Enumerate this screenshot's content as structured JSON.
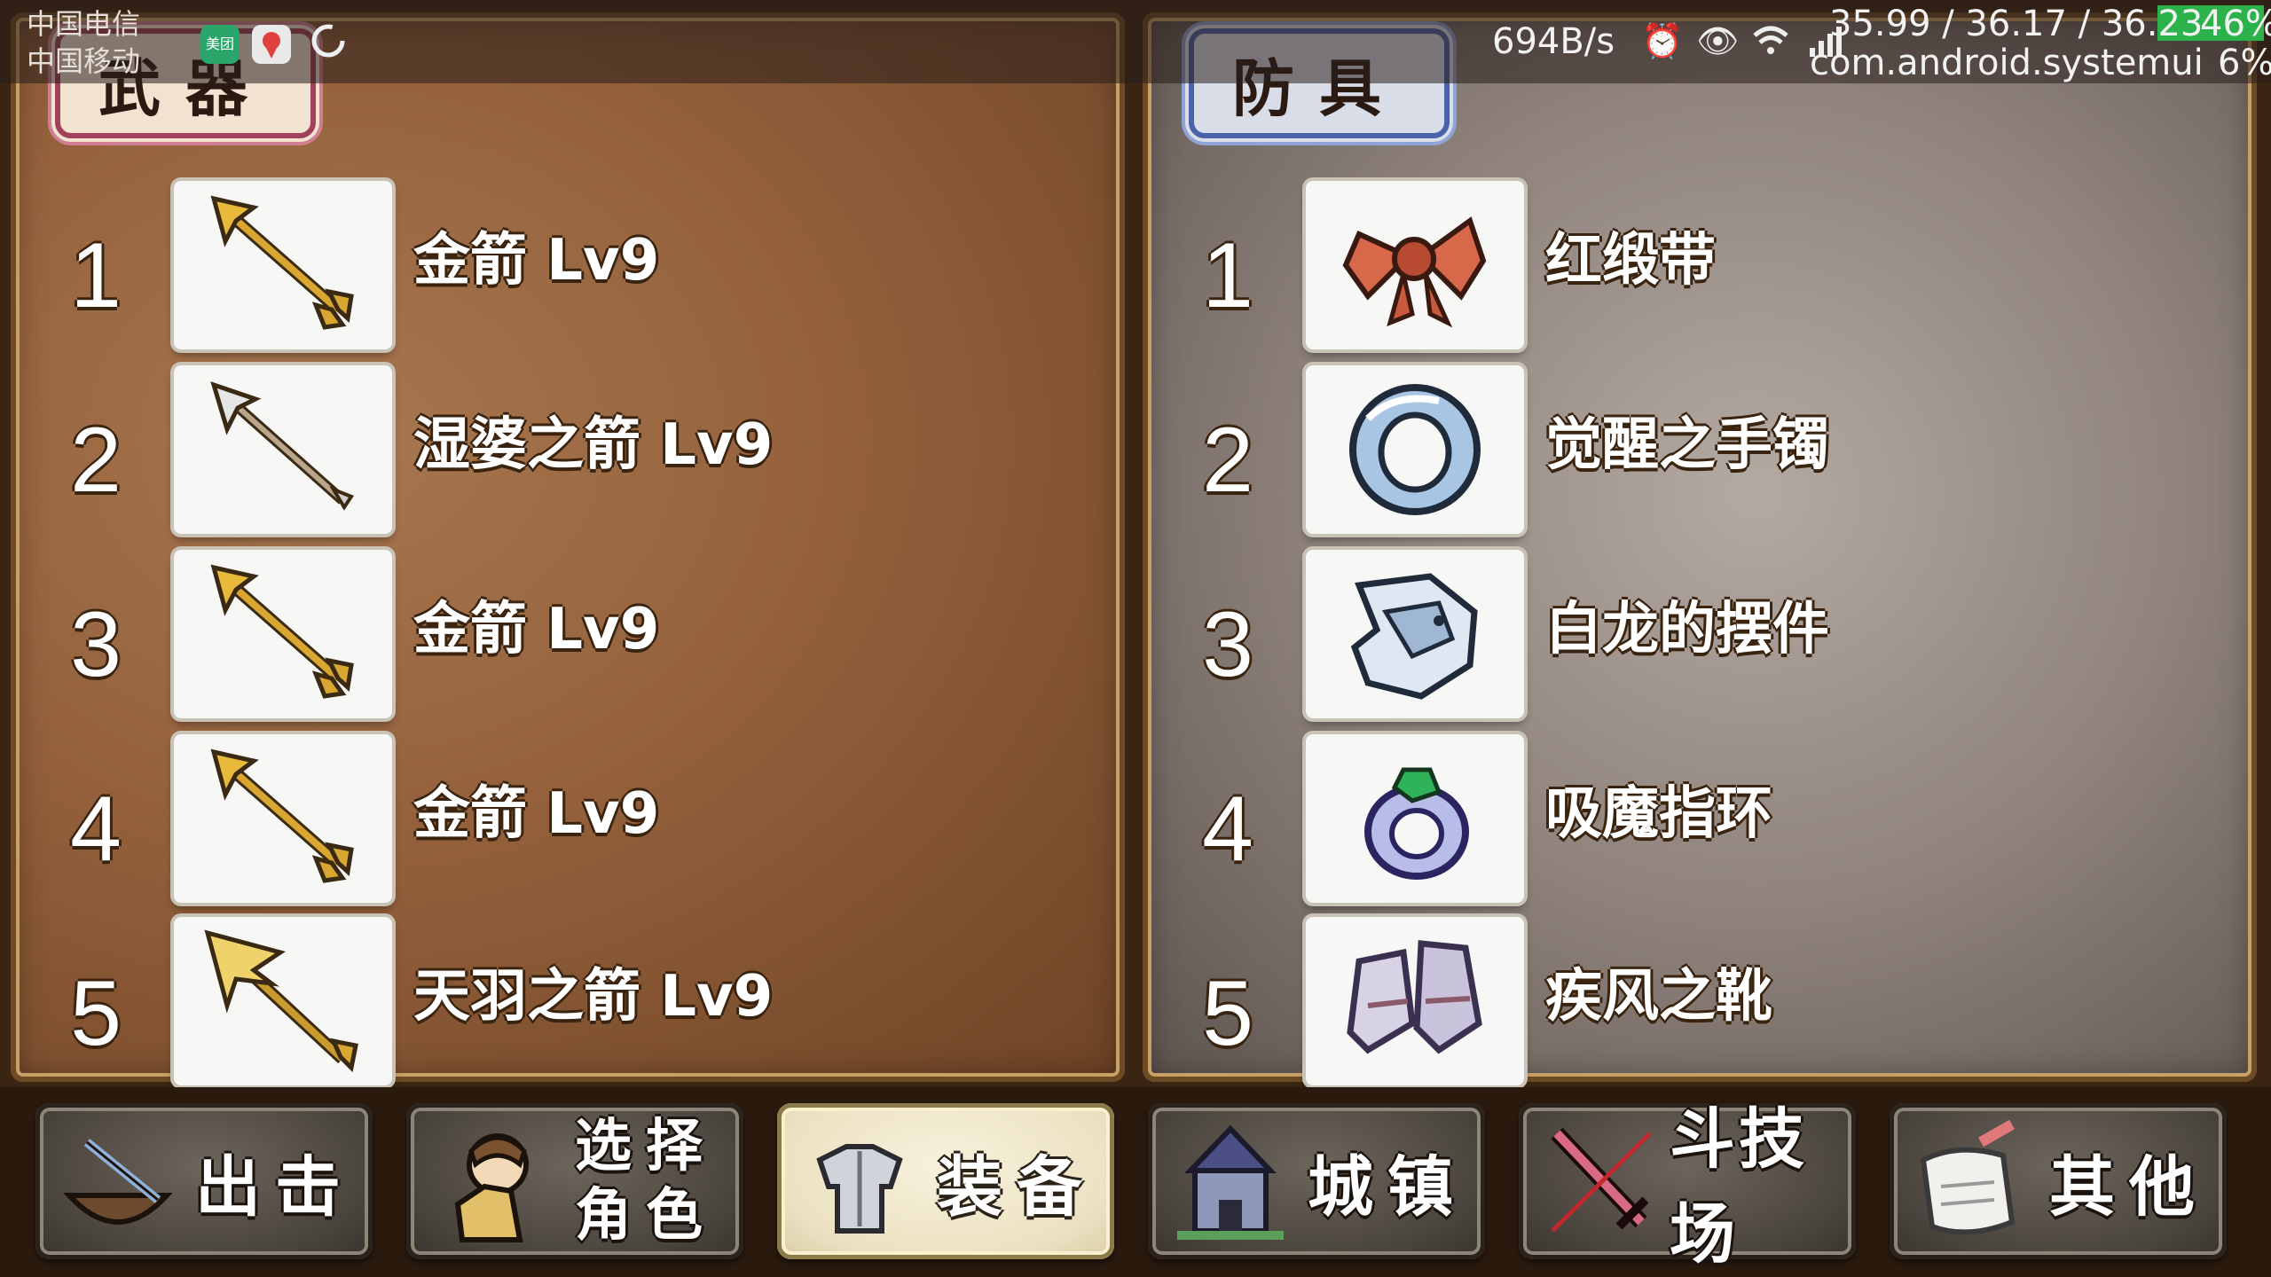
{
  "status_bar": {
    "carrier_1": "中国电信",
    "carrier_2": "中国移动",
    "network_speed": "694B/s",
    "debug_line_1": "35.99 / 36.17 / 36.23",
    "debug_line_2": "com.android.systemui",
    "battery_top": "46%",
    "battery_bottom": "6%",
    "app_badge": "美团"
  },
  "weapons": {
    "title": "武器",
    "items": [
      {
        "num": "1",
        "name": "金箭 Lv9",
        "icon": "golden-arrow-icon"
      },
      {
        "num": "2",
        "name": "湿婆之箭 Lv9",
        "icon": "silver-arrow-icon"
      },
      {
        "num": "3",
        "name": "金箭 Lv9",
        "icon": "golden-arrow-icon"
      },
      {
        "num": "4",
        "name": "金箭 Lv9",
        "icon": "golden-arrow-icon"
      },
      {
        "num": "5",
        "name": "天羽之箭 Lv9",
        "icon": "feather-arrow-icon"
      }
    ]
  },
  "armor": {
    "title": "防具",
    "items": [
      {
        "num": "1",
        "name": "红缎带",
        "icon": "red-ribbon-icon"
      },
      {
        "num": "2",
        "name": "觉醒之手镯",
        "icon": "bracelet-icon"
      },
      {
        "num": "3",
        "name": "白龙的摆件",
        "icon": "white-dragon-icon"
      },
      {
        "num": "4",
        "name": "吸魔指环",
        "icon": "ring-icon"
      },
      {
        "num": "5",
        "name": "疾风之靴",
        "icon": "boots-icon"
      }
    ]
  },
  "nav": {
    "sortie": "出击",
    "select_line1": "选择",
    "select_line2": "角色",
    "equip": "装备",
    "town": "城镇",
    "arena": "斗技场",
    "other": "其他"
  }
}
